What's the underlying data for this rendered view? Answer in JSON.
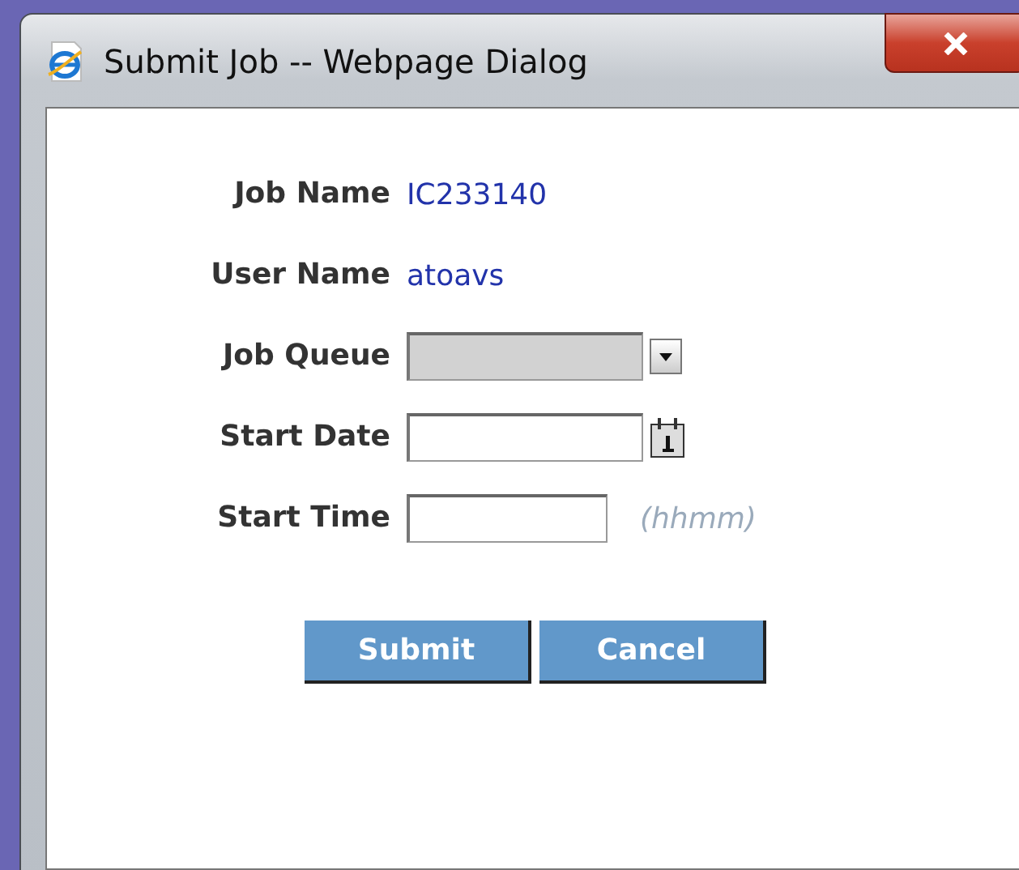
{
  "window": {
    "title": "Submit Job -- Webpage Dialog"
  },
  "fields": [
    {
      "label": "Job Name",
      "kind": "text",
      "value": "IC233140"
    },
    {
      "label": "User Name",
      "kind": "text",
      "value": "atoavs"
    },
    {
      "label": "Job Queue",
      "kind": "select",
      "disabled": true
    },
    {
      "label": "Start Date",
      "kind": "date"
    },
    {
      "label": "Start Time",
      "kind": "time",
      "hint": "(hhmm)"
    }
  ],
  "buttons": [
    "Submit",
    "Cancel"
  ]
}
